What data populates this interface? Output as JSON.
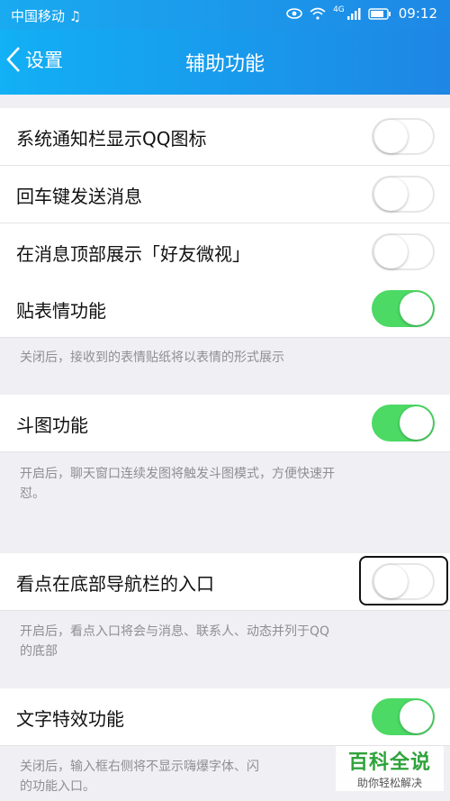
{
  "status": {
    "carrier": "中国移动",
    "network": "4G",
    "time": "09:12"
  },
  "nav": {
    "back_label": "设置",
    "title": "辅助功能"
  },
  "rows": [
    {
      "label": "系统通知栏显示QQ图标",
      "on": false
    },
    {
      "label": "回车键发送消息",
      "on": false
    },
    {
      "label": "在消息顶部展示「好友微视」",
      "on": false
    },
    {
      "label": "贴表情功能",
      "on": true
    },
    {
      "label": "斗图功能",
      "on": true
    },
    {
      "label": "看点在底部导航栏的入口",
      "on": false
    },
    {
      "label": "文字特效功能",
      "on": true
    }
  ],
  "notes": {
    "sticker": "关闭后，接收到的表情贴纸将以表情的形式展示",
    "doutu_1": "开启后，聊天窗口连续发图将触发斗图模式，方便快速开",
    "doutu_2": "怼。",
    "kandian_1": "开启后，看点入口将会与消息、联系人、动态并列于QQ",
    "kandian_2": "的底部",
    "text_effect_1": "关闭后，输入框右侧将不显示嗨爆字体、闪",
    "text_effect_2": "的功能入口。"
  },
  "watermark": {
    "line1": "百科全说",
    "line2": "助你轻松解决"
  }
}
